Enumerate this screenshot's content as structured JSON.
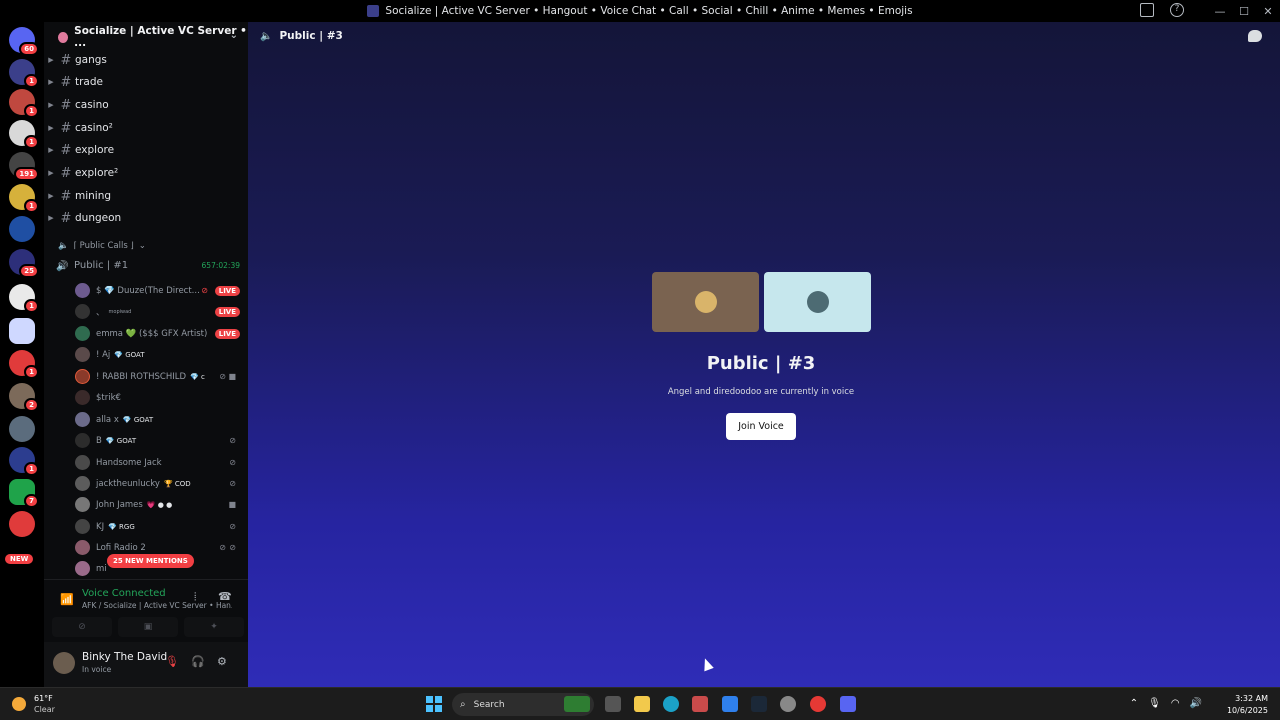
{
  "window": {
    "title": "Socialize | Active VC Server • Hangout • Voice Chat • Call • Social • Chill • Anime • Memes • Emojis",
    "controls": [
      "—",
      "☐",
      "✕"
    ]
  },
  "server_rail": {
    "home_badge": "60",
    "badges": [
      "1",
      "1",
      "1",
      "191",
      "1",
      "25",
      "1",
      "1",
      "2",
      "1",
      "7"
    ],
    "new_label": "NEW"
  },
  "server": {
    "name": "Socialize | Active VC Server • ...",
    "text_channels": [
      "gangs",
      "trade",
      "casino",
      "casino²",
      "explore",
      "explore²",
      "mining",
      "dungeon"
    ],
    "category": "⌈ Public Calls ⌋",
    "voice_channel": {
      "name": "Public | #1",
      "timer": "657:02:39",
      "members": [
        {
          "name": "$ 💎 Duuze(The Direct...",
          "tag": "",
          "live": "LIVE"
        },
        {
          "name": "、",
          "tag": "mopiwad",
          "live": "LIVE"
        },
        {
          "name": "emma 💚 ($$$ GFX Artist)",
          "tag": "",
          "live": "LIVE"
        },
        {
          "name": "! Aj",
          "tag": "💎 GOAT",
          "live": ""
        },
        {
          "name": "! RABBI ROTHSCHILD",
          "tag": "💎 c",
          "live": ""
        },
        {
          "name": "$trik€",
          "tag": "",
          "live": ""
        },
        {
          "name": "alla x",
          "tag": "💎 GOAT",
          "live": ""
        },
        {
          "name": "B",
          "tag": "💎 GOAT",
          "live": ""
        },
        {
          "name": "Handsome Jack",
          "tag": "",
          "live": ""
        },
        {
          "name": "jacktheunlucky",
          "tag": "🏆 COD",
          "live": ""
        },
        {
          "name": "John James",
          "tag": "💗 ● ●",
          "live": ""
        },
        {
          "name": "KJ",
          "tag": "💎 RGG",
          "live": ""
        },
        {
          "name": "Lofi Radio 2",
          "tag": "",
          "live": ""
        },
        {
          "name": "mi",
          "tag": "",
          "live": ""
        }
      ]
    },
    "mentions_banner": "25 NEW MENTIONS"
  },
  "voice_status": {
    "title": "Voice Connected",
    "subtitle": "AFK / Socialize | Active VC Server • Han..."
  },
  "user": {
    "name": "Binky The David",
    "status": "In voice"
  },
  "main": {
    "channel_name": "Public | #3",
    "call_title": "Public | #3",
    "call_subtitle": "Angel and diredoodoo are currently in voice",
    "join_label": "Join Voice",
    "tile_colors": [
      "#7a6350",
      "#c6e7ed"
    ]
  },
  "taskbar": {
    "weather_temp": "61°F",
    "weather_cond": "Clear",
    "search_label": "Search",
    "time": "3:32 AM",
    "date": "10/6/2025"
  }
}
